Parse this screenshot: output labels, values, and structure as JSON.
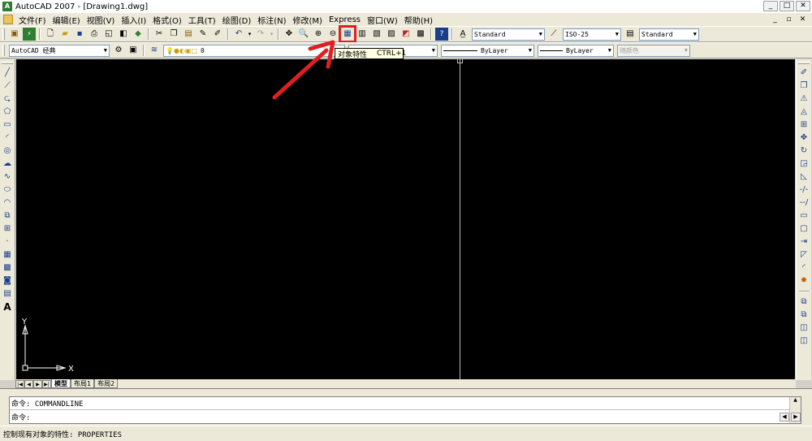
{
  "app": {
    "title": "AutoCAD 2007 - [Drawing1.dwg]",
    "icon": "autocad-logo-icon"
  },
  "window_controls": {
    "minimize": "_",
    "maximize": "□",
    "close": "✕"
  },
  "menubar": {
    "items": [
      "文件(F)",
      "编辑(E)",
      "视图(V)",
      "插入(I)",
      "格式(O)",
      "工具(T)",
      "绘图(D)",
      "标注(N)",
      "修改(M)",
      "Express",
      "窗口(W)",
      "帮助(H)"
    ],
    "doc_controls": {
      "minimize": "_",
      "restore": "▫",
      "close": "✕"
    }
  },
  "toolbar_standard": {
    "text_style": "Standard",
    "dim_style": "ISO-25",
    "table_style": "Standard",
    "highlighted_button": "properties-button"
  },
  "toolbar_layers": {
    "workspace": "AutoCAD 经典",
    "current_layer": "0",
    "layer_combo": "ayer",
    "linetype": "ByLayer",
    "lineweight": "ByLayer",
    "plotstyle": "随颜色"
  },
  "tooltip": {
    "label": "对象特性",
    "shortcut": "CTRL+1"
  },
  "left_toolbar": {
    "text_tool_glyph": "A"
  },
  "ucs": {
    "x_label": "X",
    "y_label": "Y"
  },
  "layout_tabs": {
    "tabs": [
      "模型",
      "布局1",
      "布局2"
    ],
    "active": "模型",
    "nav": [
      "|◀",
      "◀",
      "▶",
      "▶|"
    ]
  },
  "command": {
    "line1": "命令: COMMANDLINE",
    "line2": "命令:"
  },
  "statusbar": {
    "text": "控制现有对象的特性:  PROPERTIES"
  },
  "colors": {
    "canvas": "#000000",
    "annotation_arrow": "#e02020",
    "ui_face": "#ece9d8"
  }
}
